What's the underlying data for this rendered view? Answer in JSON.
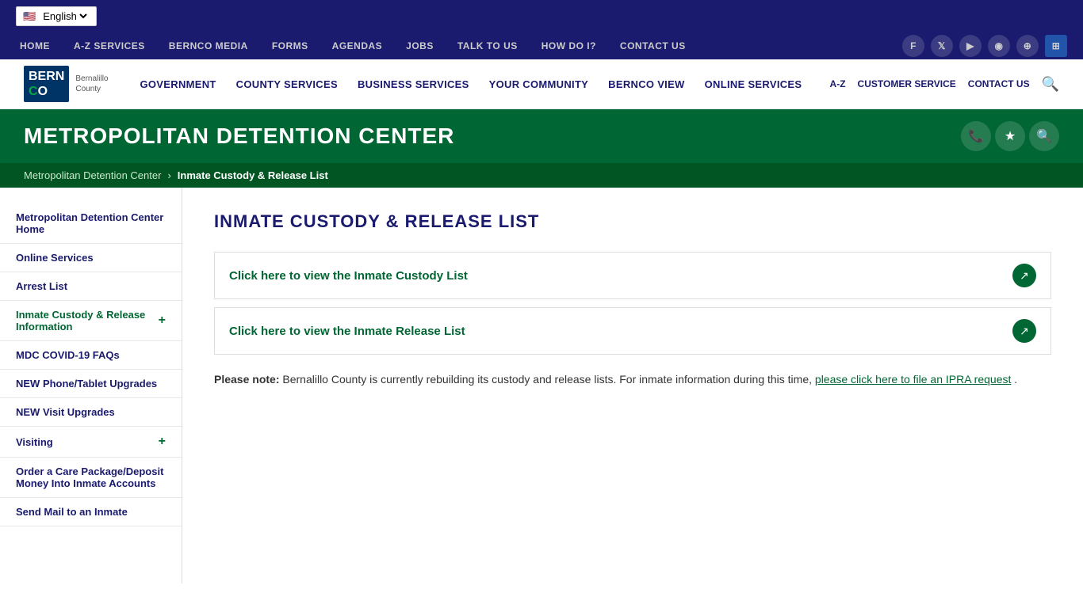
{
  "topbar": {
    "language": "English",
    "language_flag": "🇺🇸"
  },
  "navbar": {
    "items": [
      {
        "label": "HOME",
        "id": "home"
      },
      {
        "label": "A-Z SERVICES",
        "id": "az-services"
      },
      {
        "label": "BERNCO MEDIA",
        "id": "bernco-media"
      },
      {
        "label": "FORMS",
        "id": "forms"
      },
      {
        "label": "AGENDAS",
        "id": "agendas"
      },
      {
        "label": "JOBS",
        "id": "jobs"
      },
      {
        "label": "TALK TO US",
        "id": "talk-to-us"
      },
      {
        "label": "HOW DO I?",
        "id": "how-do-i"
      },
      {
        "label": "CONTACT US",
        "id": "contact-us"
      }
    ],
    "social": [
      {
        "name": "facebook",
        "icon": "f"
      },
      {
        "name": "twitter",
        "icon": "t"
      },
      {
        "name": "youtube",
        "icon": "▶"
      },
      {
        "name": "instagram",
        "icon": "◉"
      },
      {
        "name": "flickr",
        "icon": "⊕"
      },
      {
        "name": "grid",
        "icon": "⊞"
      }
    ]
  },
  "header": {
    "logo_line1": "BERN",
    "logo_line2": "CO",
    "logo_sub": "Bernalillo\nCounty",
    "nav_items": [
      {
        "label": "GOVERNMENT",
        "id": "government"
      },
      {
        "label": "COUNTY SERVICES",
        "id": "county-services"
      },
      {
        "label": "BUSINESS SERVICES",
        "id": "business-services"
      },
      {
        "label": "YOUR COMMUNITY",
        "id": "your-community"
      },
      {
        "label": "BERNCO VIEW",
        "id": "bernco-view"
      },
      {
        "label": "ONLINE SERVICES",
        "id": "online-services"
      }
    ],
    "right_links": [
      {
        "label": "A-Z",
        "id": "az"
      },
      {
        "label": "CUSTOMER SERVICE",
        "id": "customer-service"
      },
      {
        "label": "CONTACT US",
        "id": "contact-us"
      }
    ]
  },
  "banner": {
    "title": "METROPOLITAN DETENTION CENTER",
    "icons": [
      "phone",
      "star",
      "search"
    ]
  },
  "breadcrumb": {
    "home": "Metropolitan Detention Center",
    "current": "Inmate Custody & Release List"
  },
  "sidebar": {
    "items": [
      {
        "label": "Metropolitan Detention Center Home",
        "id": "mdc-home",
        "has_plus": false
      },
      {
        "label": "Online Services",
        "id": "online-services",
        "has_plus": false
      },
      {
        "label": "Arrest List",
        "id": "arrest-list",
        "has_plus": false
      },
      {
        "label": "Inmate Custody & Release Information",
        "id": "inmate-custody",
        "has_plus": true,
        "active": true
      },
      {
        "label": "MDC COVID-19 FAQs",
        "id": "mdc-covid",
        "has_plus": false
      },
      {
        "label": "NEW Phone/Tablet Upgrades",
        "id": "phone-tablet",
        "has_plus": false
      },
      {
        "label": "NEW Visit Upgrades",
        "id": "visit-upgrades",
        "has_plus": false
      },
      {
        "label": "Visiting",
        "id": "visiting",
        "has_plus": true
      },
      {
        "label": "Order a Care Package/Deposit Money Into Inmate Accounts",
        "id": "care-package",
        "has_plus": false
      },
      {
        "label": "Send Mail to an Inmate",
        "id": "send-mail",
        "has_plus": false
      }
    ]
  },
  "main": {
    "page_title": "INMATE CUSTODY & RELEASE LIST",
    "link_boxes": [
      {
        "label": "Click here to view the Inmate Custody List",
        "id": "custody-link"
      },
      {
        "label": "Click here to view the Inmate Release List",
        "id": "release-link"
      }
    ],
    "note": {
      "bold_prefix": "Please note:",
      "text": " Bernalillo County is currently rebuilding its custody and release lists. For inmate information during this time, ",
      "link_text": "please click here to file an IPRA request",
      "suffix": "."
    }
  }
}
